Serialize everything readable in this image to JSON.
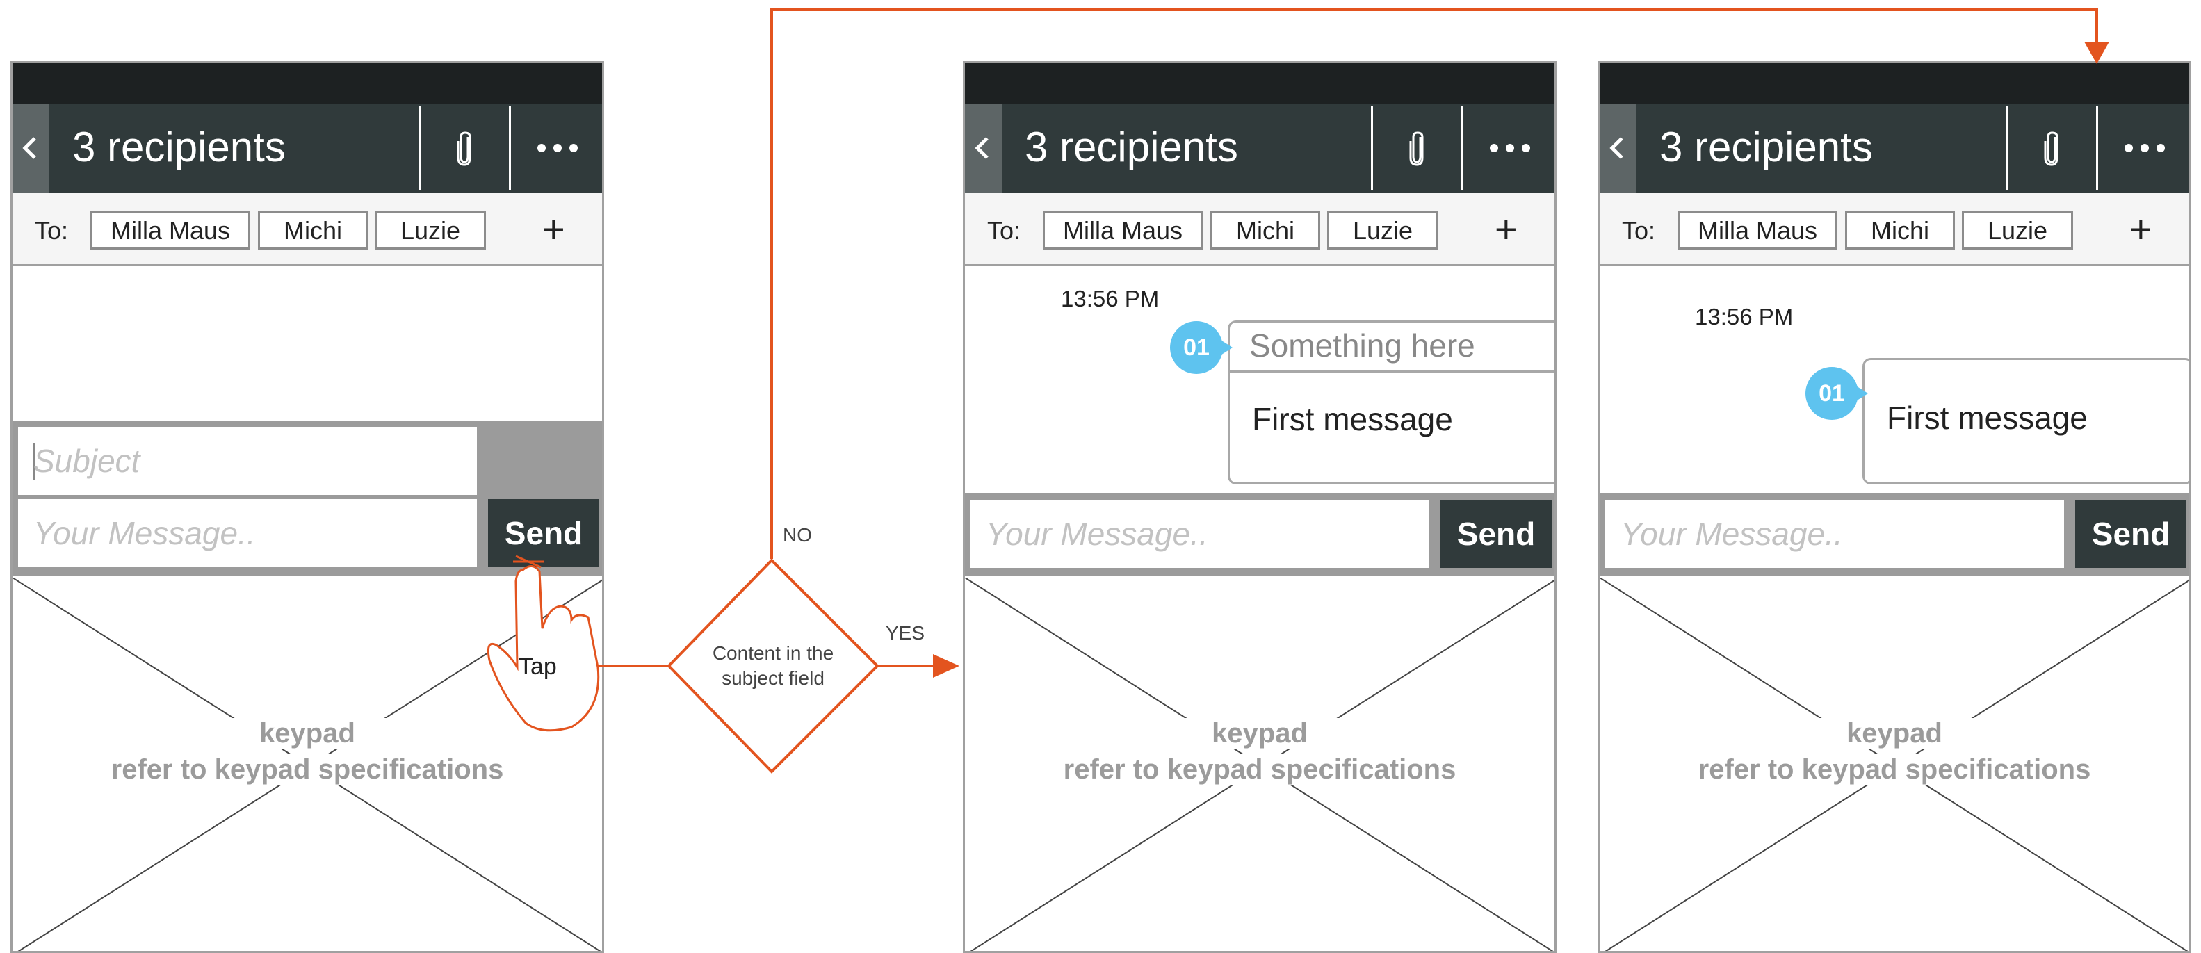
{
  "colors": {
    "accent": "#e3541f",
    "titlebar": "#303a3b",
    "back_button": "#5d6566",
    "badge": "#5ec3ef",
    "keypad_text": "#9b9b9b"
  },
  "screens": [
    {
      "title": "3 recipients",
      "to_label": "To:",
      "recipients": [
        "Milla Maus",
        "Michi",
        "Luzie"
      ],
      "add_label": "+",
      "subject_placeholder": "Subject",
      "message_placeholder": "Your Message..",
      "send_label": "Send",
      "keypad_line1": "keypad",
      "keypad_line2": "refer to keypad specifications"
    },
    {
      "title": "3 recipients",
      "to_label": "To:",
      "recipients": [
        "Milla Maus",
        "Michi",
        "Luzie"
      ],
      "add_label": "+",
      "timestamp": "13:56 PM",
      "badge": "01",
      "bubble_subject": "Something here",
      "bubble_message": "First message",
      "message_placeholder": "Your Message..",
      "send_label": "Send",
      "keypad_line1": "keypad",
      "keypad_line2": "refer to keypad specifications"
    },
    {
      "title": "3 recipients",
      "to_label": "To:",
      "recipients": [
        "Milla Maus",
        "Michi",
        "Luzie"
      ],
      "add_label": "+",
      "timestamp": "13:56 PM",
      "badge": "01",
      "bubble_message": "First message",
      "message_placeholder": "Your Message..",
      "send_label": "Send",
      "keypad_line1": "keypad",
      "keypad_line2": "refer to keypad specifications"
    }
  ],
  "flow": {
    "tap_label": "Tap",
    "decision_line1": "Content in the",
    "decision_line2": "subject field",
    "no_label": "NO",
    "yes_label": "YES"
  },
  "icons": {
    "back": "chevron-left-icon",
    "attach": "paperclip-icon",
    "more": "more-horizontal-icon",
    "hand": "tap-hand-icon"
  }
}
